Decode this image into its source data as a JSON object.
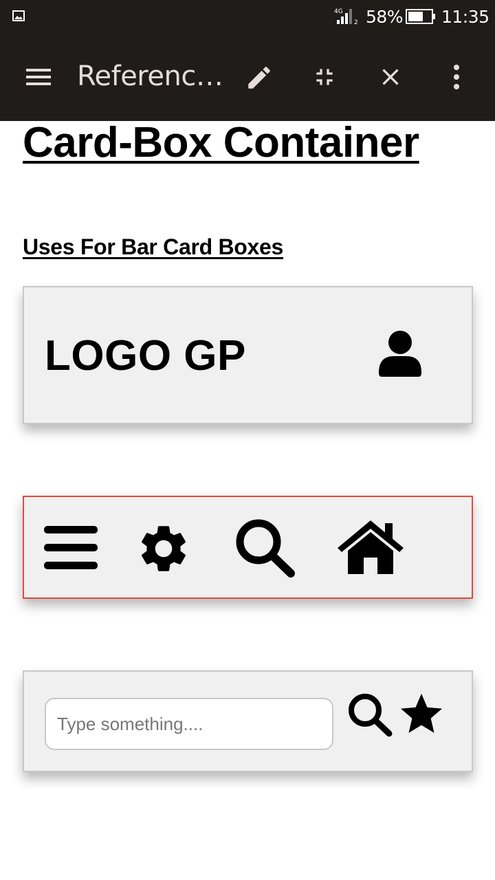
{
  "status_bar": {
    "network": "4G",
    "sim": "2",
    "battery_percent": "58%",
    "time": "11:35",
    "icons": [
      "image-icon",
      "signal-icon",
      "battery-icon"
    ]
  },
  "toolbar": {
    "title": "Referenc…",
    "icons": [
      "menu-icon",
      "edit-icon",
      "compress-icon",
      "close-icon",
      "more-vert-icon"
    ]
  },
  "page": {
    "title": "Card-Box Container",
    "section_title": "Uses For Bar Card Boxes"
  },
  "card1": {
    "logo": "LOGO GP",
    "icon": "user-icon"
  },
  "card2": {
    "icons": [
      "bars-icon",
      "gear-icon",
      "search-icon",
      "home-icon"
    ],
    "border_color": "#e04a3e"
  },
  "card3": {
    "input_placeholder": "Type something....",
    "input_value": "",
    "icons": [
      "search-icon",
      "star-icon"
    ]
  },
  "colors": {
    "toolbar_bg": "#201c1a",
    "card_bg": "#f0f0f0",
    "card_border": "#c8c8c8",
    "toolbar_icon": "#e6dcd8"
  }
}
